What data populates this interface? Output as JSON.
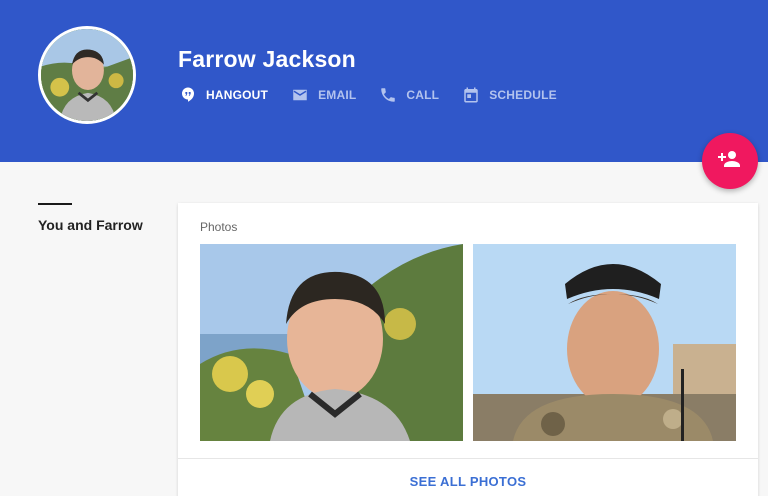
{
  "profile": {
    "name": "Farrow Jackson"
  },
  "actions": [
    {
      "label": "HANGOUT",
      "icon": "hangout-icon",
      "active": true
    },
    {
      "label": "EMAIL",
      "icon": "email-icon",
      "active": false
    },
    {
      "label": "CALL",
      "icon": "phone-icon",
      "active": false
    },
    {
      "label": "SCHEDULE",
      "icon": "calendar-icon",
      "active": false
    }
  ],
  "fab": {
    "icon": "add-person-icon"
  },
  "sidebar": {
    "section_label": "You and Farrow"
  },
  "photos_card": {
    "title": "Photos",
    "see_all": "SEE ALL PHOTOS"
  },
  "colors": {
    "header": "#3057c9",
    "fab": "#f0185f",
    "link": "#3b6fd4"
  }
}
